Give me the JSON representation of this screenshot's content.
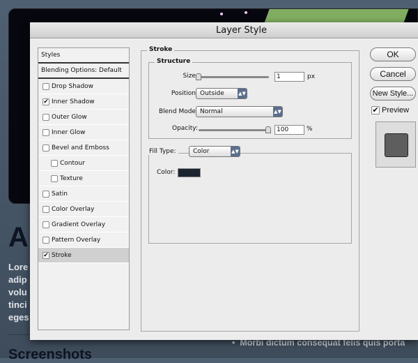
{
  "background": {
    "heading": "Au",
    "paragraph": [
      "Lore",
      "adip",
      "volu",
      "tinci",
      "eges"
    ],
    "heading2": "Screenshots",
    "bullet": "Morbi dictum consequat felis quis porta"
  },
  "dialog": {
    "title": "Layer Style",
    "styles_list": {
      "header": "Styles",
      "blending": "Blending Options: Default",
      "items": [
        {
          "label": "Drop Shadow",
          "checked": false
        },
        {
          "label": "Inner Shadow",
          "checked": true
        },
        {
          "label": "Outer Glow",
          "checked": false
        },
        {
          "label": "Inner Glow",
          "checked": false
        },
        {
          "label": "Bevel and Emboss",
          "checked": false
        },
        {
          "label": "Contour",
          "checked": false
        },
        {
          "label": "Texture",
          "checked": false
        },
        {
          "label": "Satin",
          "checked": false
        },
        {
          "label": "Color Overlay",
          "checked": false
        },
        {
          "label": "Gradient Overlay",
          "checked": false
        },
        {
          "label": "Pattern Overlay",
          "checked": false
        },
        {
          "label": "Stroke",
          "checked": true,
          "selected": true
        }
      ]
    },
    "stroke": {
      "title": "Stroke",
      "structure": "Structure",
      "size_label": "Size:",
      "size_value": "1",
      "size_unit": "px",
      "position_label": "Position:",
      "position_value": "Outside",
      "blend_label": "Blend Mode:",
      "blend_value": "Normal",
      "opacity_label": "Opacity:",
      "opacity_value": "100",
      "opacity_unit": "%",
      "fill_type_label": "Fill Type:",
      "fill_type_value": "Color",
      "color_label": "Color:",
      "color": "#1c2430"
    },
    "buttons": {
      "ok": "OK",
      "cancel": "Cancel",
      "new_style": "New Style...",
      "preview": "Preview",
      "preview_checked": true
    }
  }
}
